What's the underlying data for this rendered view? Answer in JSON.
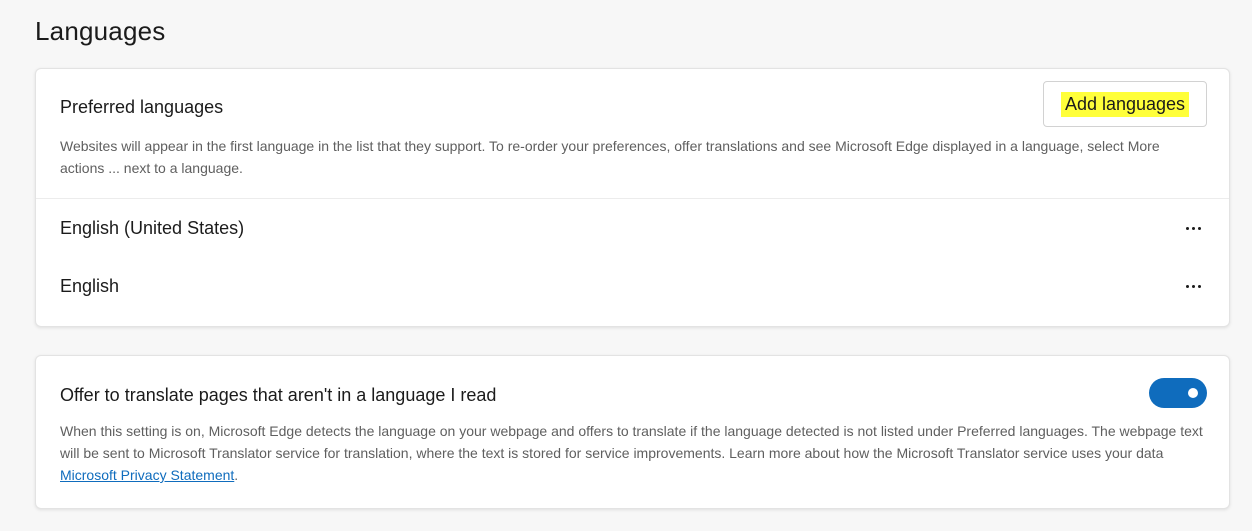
{
  "page": {
    "title": "Languages"
  },
  "preferred": {
    "title": "Preferred languages",
    "description": "Websites will appear in the first language in the list that they support. To re-order your preferences, offer translations and see Microsoft Edge displayed in a language, select More actions ... next to a language.",
    "add_label": "Add languages",
    "languages": [
      {
        "label": "English (United States)",
        "actions_icon": "more-horizontal-icon"
      },
      {
        "label": "English",
        "actions_icon": "more-horizontal-icon"
      }
    ]
  },
  "translate": {
    "title": "Offer to translate pages that aren't in a language I read",
    "description": "When this setting is on, Microsoft Edge detects the language on your webpage and offers to translate if the language detected is not listed under Preferred languages. The webpage text will be sent to Microsoft Translator service for translation, where the text is stored for service improvements. Learn more about how the Microsoft Translator service uses your data ",
    "link_text": "Microsoft Privacy Statement",
    "link_suffix": ".",
    "enabled": true
  },
  "colors": {
    "accent": "#0f6cbd",
    "highlight": "#ffff3a",
    "background": "#f7f7f7",
    "card": "#ffffff",
    "muted_text": "#5f5f5f"
  }
}
